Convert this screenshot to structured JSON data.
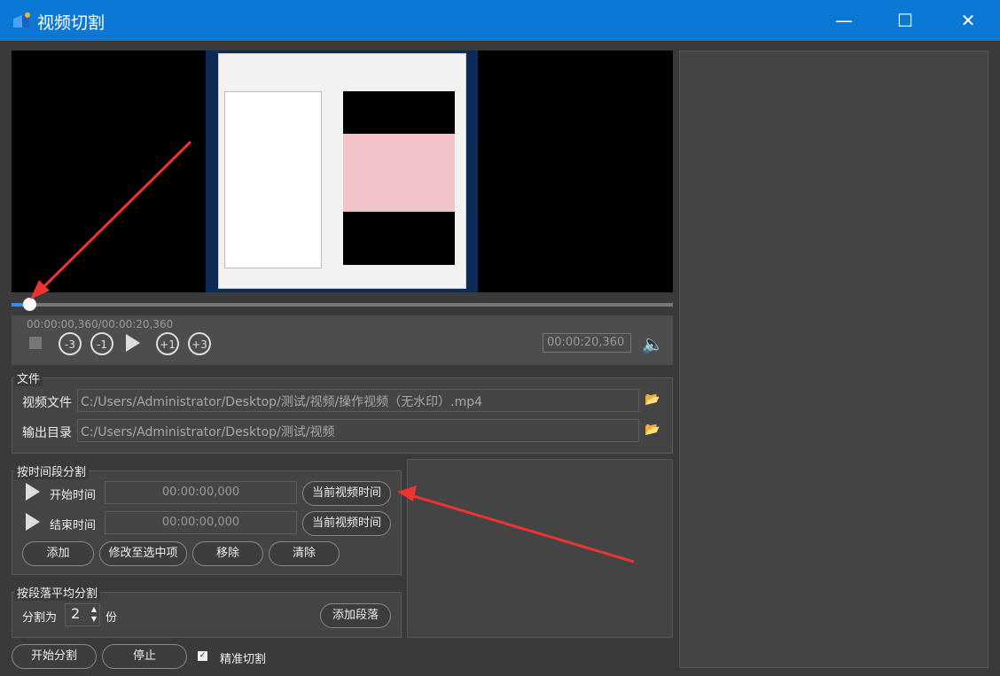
{
  "window": {
    "title": "视频切割",
    "minimize_icon": "minimize-icon",
    "maximize_icon": "maximize-icon",
    "close_icon": "close-icon"
  },
  "player": {
    "current_time": "00:00:00,360",
    "total_time": "00:00:20,360",
    "time_display": "00:00:00,360/00:00:20,360",
    "end_time_field": "00:00:20,360",
    "progress_percent": 1.8,
    "buttons": {
      "back3": "-3",
      "back1": "-1",
      "fwd1": "+1",
      "fwd3": "+3"
    }
  },
  "file_section": {
    "title": "文件",
    "video_label": "视频文件",
    "video_path": "C:/Users/Administrator/Desktop/测试/视频/操作视频（无水印）.mp4",
    "output_label": "输出目录",
    "output_path": "C:/Users/Administrator/Desktop/测试/视频"
  },
  "time_split": {
    "title": "按时间段分割",
    "start_label": "开始时间",
    "start_value": "00:00:00,000",
    "end_label": "结束时间",
    "end_value": "00:00:00,000",
    "current_time_button": "当前视频时间",
    "add": "添加",
    "modify": "修改至选中项",
    "remove": "移除",
    "clear": "清除"
  },
  "segment_split": {
    "title": "按段落平均分割",
    "split_into": "分割为",
    "count": "2",
    "unit": "份",
    "add_segment": "添加段落"
  },
  "bottom": {
    "start": "开始分割",
    "stop": "停止",
    "precise_label": "精准切割",
    "precise_checked": true
  },
  "colors": {
    "titlebar": "#0b78d6",
    "accent": "#2f8ff0",
    "annotation": "#ee3333"
  }
}
